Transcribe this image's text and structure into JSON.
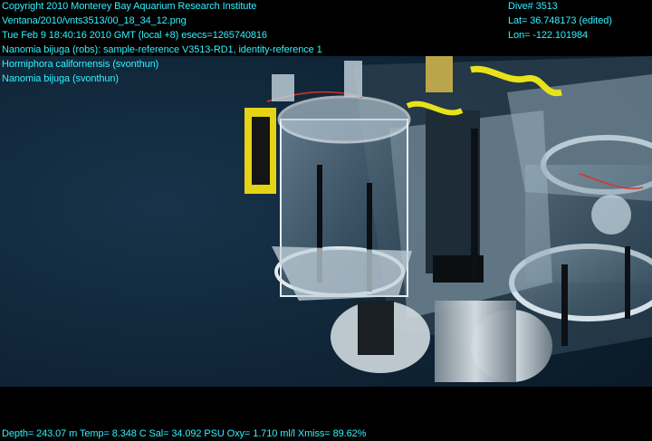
{
  "overlay": {
    "copyright": "Copyright 2010 Monterey Bay Aquarium Research Institute",
    "filename": "Ventana/2010/vnts3513/00_18_34_12.png",
    "timestamp": "Tue Feb  9 18:40:16 2010 GMT (local +8)  esecs=1265740816",
    "annotation_1": "Nanomia bijuga (robs): sample-reference V3513-RD1, identity-reference 1",
    "annotation_2": "Hormiphora californensis (svonthun)",
    "annotation_3": "Nanomia bijuga (svonthun)",
    "dive": "Dive# 3513",
    "lat": "Lat= 36.748173 (edited)",
    "lon": "Lon= -122.101984",
    "sensors": "Depth= 243.07 m  Temp= 8.348 C  Sal= 34.092 PSU  Oxy= 1.710 ml/l  Xmiss= 89.62%"
  },
  "colors": {
    "overlay_text": "#2ff2ff",
    "water": "#0f2233",
    "letterbox": "#000000"
  }
}
